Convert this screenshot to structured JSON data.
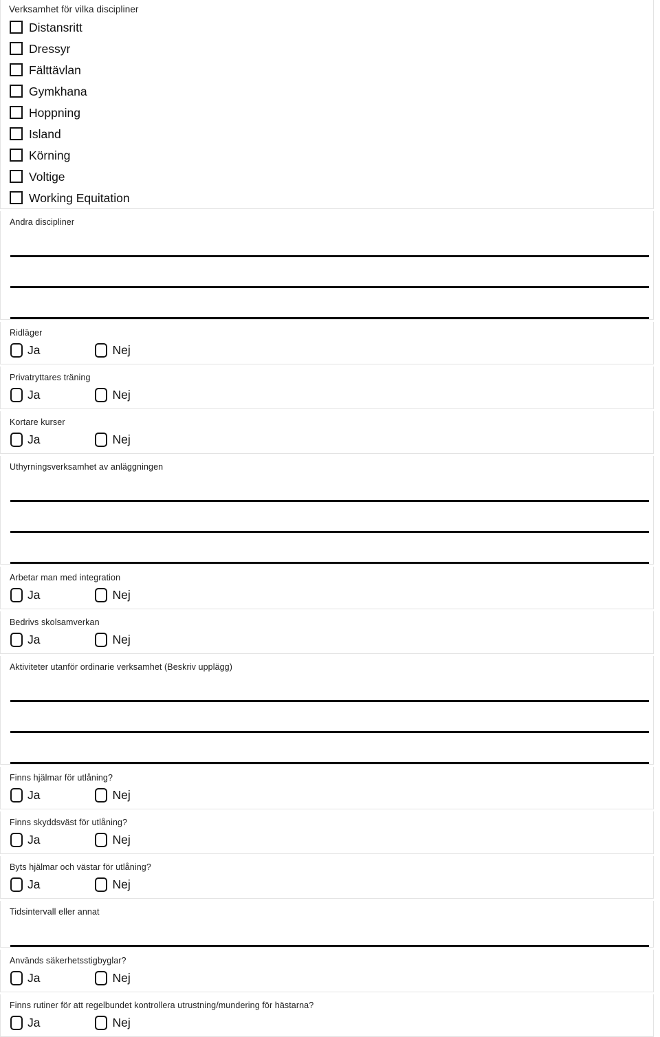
{
  "form": {
    "disciplines_section": {
      "title": "Verksamhet för vilka discipliner",
      "options": [
        "Distansritt",
        "Dressyr",
        "Fälttävlan",
        "Gymkhana",
        "Hoppning",
        "Island",
        "Körning",
        "Voltige",
        "Working Equitation"
      ]
    },
    "yes_label": "Ja",
    "no_label": "Nej",
    "sections": [
      {
        "type": "text",
        "label": "Andra discipliner",
        "lines": 3,
        "value": ""
      },
      {
        "type": "yesno",
        "label": "Ridläger",
        "value": ""
      },
      {
        "type": "yesno",
        "label": "Privatryttares träning",
        "value": ""
      },
      {
        "type": "yesno",
        "label": "Kortare kurser",
        "value": ""
      },
      {
        "type": "text",
        "label": "Uthyrningsverksamhet av anläggningen",
        "lines": 3,
        "value": ""
      },
      {
        "type": "yesno",
        "label": "Arbetar man med integration",
        "value": ""
      },
      {
        "type": "yesno",
        "label": "Bedrivs skolsamverkan",
        "value": ""
      },
      {
        "type": "text",
        "label": "Aktiviteter utanför ordinarie verksamhet (Beskriv upplägg)",
        "lines": 3,
        "value": ""
      },
      {
        "type": "yesno",
        "label": "Finns hjälmar för utlåning?",
        "value": ""
      },
      {
        "type": "yesno",
        "label": "Finns skyddsväst för utlåning?",
        "value": ""
      },
      {
        "type": "yesno",
        "label": "Byts hjälmar och västar för utlåning?",
        "value": ""
      },
      {
        "type": "text",
        "label": "Tidsintervall eller annat",
        "lines": 1,
        "value": ""
      },
      {
        "type": "yesno",
        "label": "Används säkerhetsstigbyglar?",
        "value": ""
      },
      {
        "type": "yesno",
        "label": "Finns rutiner för att regelbundet kontrollera utrustning/mundering för hästarna?",
        "value": ""
      }
    ]
  }
}
